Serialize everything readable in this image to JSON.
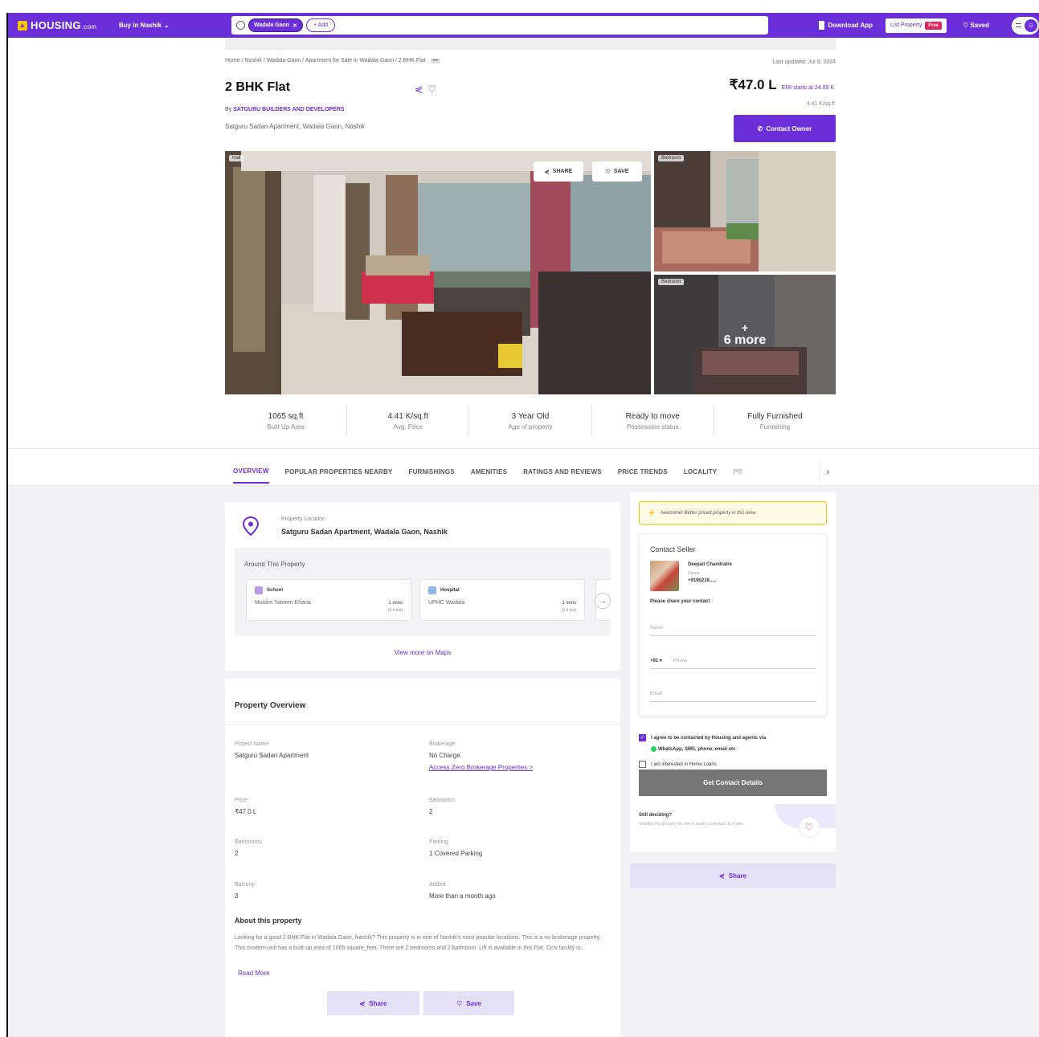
{
  "nav": {
    "logo": "HOUSING",
    "logo_suffix": ".com",
    "buy_in": "Buy in Nashik",
    "search_chip": "Wadala Gaon",
    "search_add": "+ Add",
    "download_app": "Download App",
    "list_property": "List Property",
    "free_badge": "Free",
    "saved": "Saved"
  },
  "breadcrumb": "Home / Nashik / Wadala Gaon / Apartment for Sale in Wadala Gaon / 2 BHK Flat",
  "last_updated": "Last updated: Jul 9, 2024",
  "title": "2 BHK Flat",
  "price": "₹47.0 L",
  "emi": "EMI starts at  24.89 K",
  "price_per_sqft": "4.41 K/sq.ft",
  "byline_prefix": "By",
  "builder": "SATGURU BUILDERS AND DEVELOPERS",
  "address": "Satguru Sadan Apartment, Wadala Gaon, Nashik",
  "contact_owner": "Contact Owner",
  "gallery": {
    "main_tag": "Hall",
    "side1_tag": "Bedroom",
    "side2_tag": "Bedroom",
    "share": "SHARE",
    "save": "SAVE",
    "more_plus": "+",
    "more_count": "6 more"
  },
  "stats": [
    {
      "value": "1065 sq.ft",
      "label": "Built Up Area"
    },
    {
      "value": "4.41 K/sq.ft",
      "label": "Avg. Price"
    },
    {
      "value": "3 Year Old",
      "label": "Age of property"
    },
    {
      "value": "Ready to move",
      "label": "Possession status"
    },
    {
      "value": "Fully Furnished",
      "label": "Furnishing"
    }
  ],
  "tabs": [
    "OVERVIEW",
    "POPULAR PROPERTIES NEARBY",
    "FURNISHINGS",
    "AMENITIES",
    "RATINGS AND REVIEWS",
    "PRICE TRENDS",
    "LOCALITY",
    "PR"
  ],
  "location": {
    "label": "Property Location",
    "name": "Satguru Sadan Apartment, Wadala Gaon, Nashik",
    "around_title": "Around This Property",
    "pois": [
      {
        "category": "School",
        "name": "Muslim Yateem Khana",
        "time": "1 mins",
        "distance": "(0.4 km)"
      },
      {
        "category": "Hospital",
        "name": "UPHC Wadala",
        "time": "1 mins",
        "distance": "(0.4 km)"
      }
    ],
    "view_maps": "View more on Maps"
  },
  "overview": {
    "title": "Property Overview",
    "fields": [
      {
        "key": "Project Name",
        "value": "Satguru Sadan Apartment"
      },
      {
        "key": "Brokerage",
        "value": "No Charge",
        "link": "Access Zero Brokerage Properties >"
      },
      {
        "key": "Price",
        "value": "₹47.0 L"
      },
      {
        "key": "Bedrooms",
        "value": "2"
      },
      {
        "key": "Bathrooms",
        "value": "2"
      },
      {
        "key": "Parking",
        "value": "1 Covered Parking"
      },
      {
        "key": "Balcony",
        "value": "3"
      },
      {
        "key": "Added",
        "value": "More than a month ago"
      }
    ],
    "about_title": "About this property",
    "about_text": "Looking for a good 2 BHK Flat in Wadala Gaon, Nashik? This property is in one of Nashik's most popular locations. This is a no brokerage property. This modern unit has a built-up area of 1065 square_feet. There are 2 bedrooms and 2 bathroom. Lift is available in this Flat. Cctv facility is...",
    "read_more": "Read More",
    "share": "Share",
    "save": "Save"
  },
  "seller": {
    "alert": "Awesome! Better priced property in this area",
    "title": "Contact Seller",
    "name": "Deepali Chandratre",
    "role": "Owner",
    "phone": "+9190218.....",
    "share_prompt": "Please share your contact",
    "name_placeholder": "Name",
    "country_code": "+91",
    "phone_placeholder": "Phone",
    "email_placeholder": "Email",
    "agree_text": "I agree to be contacted by Housing and agents via",
    "agree_text2": "WhatsApp, SMS, phone, email etc",
    "home_loans": "I am interested in Home Loans",
    "get_details": "Get Contact Details",
    "still_title": "Still deciding?",
    "still_text": "Shortlist this property for now & easily come back to it later.",
    "share": "Share"
  },
  "colors": {
    "brand": "#6a2fd8",
    "badge": "#e0245e"
  }
}
